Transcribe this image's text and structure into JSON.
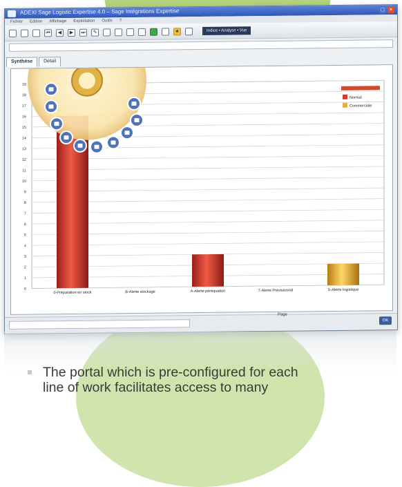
{
  "window": {
    "title": "ADEXI Sage Logistic Expertise 4.0 – Sage Intégrations Expertise"
  },
  "menu": {
    "items": [
      "Fichier",
      "Edition",
      "Affichage",
      "Exploitation",
      "Outils",
      "?"
    ]
  },
  "toolbar": {
    "breadcrumb": "Indice • Analyse • Vue"
  },
  "tabs": [
    {
      "label": "Synthèse"
    },
    {
      "label": "Détail"
    }
  ],
  "chart_data": {
    "type": "bar",
    "categories": [
      "0-Préparation en stock",
      "B-Alerte stockage",
      "A-Alerte péréquation",
      "7-Alerte Prévisionnel",
      "S-Alerte logistique"
    ],
    "series": [
      {
        "name": "Normal",
        "color": "#d83a2e",
        "values": [
          16,
          0,
          3,
          0,
          0
        ]
      },
      {
        "name": "Commerciale",
        "color": "#e8b23a",
        "values": [
          0,
          0,
          0,
          0,
          2
        ]
      }
    ],
    "ylim": [
      0,
      19
    ],
    "yticks": [
      0,
      1,
      2,
      3,
      4,
      5,
      6,
      7,
      8,
      9,
      10,
      11,
      12,
      13,
      14,
      15,
      16,
      17,
      18,
      19
    ],
    "grid": true,
    "legend_position": "top-right"
  },
  "status": {
    "page_label": "Page",
    "ok_label": "OK"
  },
  "caption": {
    "line1": "The portal which is pre-configured for each",
    "line2": "line of work facilitates access to many"
  }
}
